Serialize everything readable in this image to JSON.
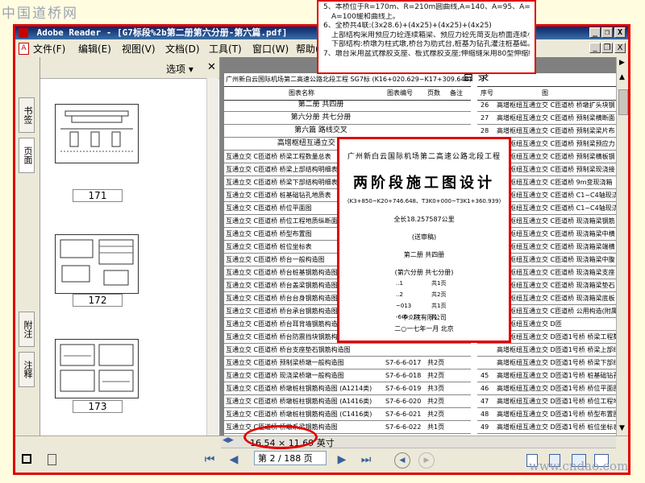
{
  "watermarks": {
    "top_left": "中国道桥网",
    "bottom_right": "www.cndao.com"
  },
  "window": {
    "title": "Adobe Reader - [G7标段%2b第二册第六分册-第六篇.pdf]",
    "minimize": "_",
    "restore": "❐",
    "close": "X"
  },
  "menubar": {
    "items": [
      "文件(F)",
      "编辑(E)",
      "视图(V)",
      "文档(D)",
      "工具(T)",
      "窗口(W)",
      "帮助(H)"
    ],
    "doc_min": "_",
    "doc_restore": "❐",
    "doc_close": "X"
  },
  "nav_tabs": [
    "书签",
    "页面",
    "附注",
    "注释"
  ],
  "pages_panel": {
    "options_label": "选项 ▾",
    "thumbnails": [
      {
        "num": "171"
      },
      {
        "num": "172"
      },
      {
        "num": "173"
      }
    ]
  },
  "doc": {
    "header_text": "广州新白云国际机场第二高速公路北段工程  SG7标  (K16+020.629~K17+309.648)",
    "left_col_headers": [
      "图表名称",
      "图表编号",
      "页数",
      "备注"
    ],
    "right_col_headers": [
      "序号",
      "图"
    ],
    "left_rows": [
      "第二册  共四册",
      "第六分册  共七分册",
      "第六篇  路线交叉",
      "高增枢纽互通立交  C匝道桥",
      "互通立交 C匝道桥 桥梁工程数量总表",
      "互通立交 C匝道桥 桥梁上部结构明细表",
      "互通立交 C匝道桥 桥梁下部结构明细表",
      "互通立交 C匝道桥 桩基础钻孔地质表",
      "互通立交 C匝道桥 桥位平面图",
      "互通立交 C匝道桥 桥位工程地质纵断面图",
      "互通立交 C匝道桥 桥型布置图",
      "互通立交 C匝道桥 桩位坐标表",
      "互通立交 C匝道桥 桥台一般构造图",
      "互通立交 C匝道桥 桥台桩基钢筋构造图 (",
      "互通立交 C匝道桥 桥台盖梁钢筋构造图",
      "互通立交 C匝道桥 桥台台身钢筋构造图",
      "互通立交 C匝道桥 桥台承台钢筋构造图",
      "互通立交 C匝道桥 桥台耳背墙钢筋构造图",
      "互通立交 C匝道桥 桥台防震挡块钢筋构造图",
      "互通立交 C匝道桥 桥台支座垫石钢筋构造图",
      "互通立交 C匝道桥 预制梁桥墩一般构造图",
      "互通立交 C匝道桥 现浇梁桥墩一般构造图",
      "互通立交 C匝道桥 桥墩桩柱钢筋构造图 (A1214类)",
      "互通立交 C匝道桥 桥墩桩柱钢筋构造图 (A1416类)",
      "互通立交 C匝道桥 桥墩桩柱钢筋构造图 (C1416类)",
      "互通立交 C匝道桥 桥墩系梁钢筋构造图"
    ],
    "left_codes": [
      {
        "code": "S7-6-6-017",
        "pages": "共2页"
      },
      {
        "code": "S7-6-6-018",
        "pages": "共2页"
      },
      {
        "code": "S7-6-6-019",
        "pages": "共3页"
      },
      {
        "code": "S7-6-6-020",
        "pages": "共2页"
      },
      {
        "code": "S7-6-6-021",
        "pages": "共2页"
      },
      {
        "code": "S7-6-6-022",
        "pages": "共1页"
      }
    ],
    "right_rows": [
      {
        "no": "26",
        "text": "高增枢纽互通立交 C匝道桥 桥墩扩头块钢"
      },
      {
        "no": "27",
        "text": "高增枢纽互通立交 C匝道桥 预制梁横断面"
      },
      {
        "no": "28",
        "text": "高增枢纽互通立交 C匝道桥 预制梁梁片布"
      },
      {
        "no": "",
        "text": "高增枢纽互通立交 C匝道桥 预制梁预应力"
      },
      {
        "no": "",
        "text": "高增枢纽互通立交 C匝道桥 预制梁横板钢"
      },
      {
        "no": "",
        "text": "高增枢纽互通立交 C匝道桥 预制梁现浇接"
      },
      {
        "no": "",
        "text": "高增枢纽互通立交 C匝道桥 9m变现浇箱"
      },
      {
        "no": "",
        "text": "高增枢纽互通立交 C匝道桥 C1~C4轴现浇"
      },
      {
        "no": "",
        "text": "高增枢纽互通立交 C匝道桥 C1~C4轴现浇"
      },
      {
        "no": "",
        "text": "高增枢纽互通立交 C匝道桥 现浇箱梁钢筋"
      },
      {
        "no": "",
        "text": "高增枢纽互通立交 C匝道桥 现浇箱梁中横"
      },
      {
        "no": "",
        "text": "高增枢纽互通立交 C匝道桥 现浇箱梁端横"
      },
      {
        "no": "",
        "text": "高增枢纽互通立交 C匝道桥 现浇箱梁中腹"
      },
      {
        "no": "",
        "text": "高增枢纽互通立交 C匝道桥 现浇箱梁支座"
      },
      {
        "no": "",
        "text": "高增枢纽互通立交 C匝道桥 现浇箱梁垫石"
      },
      {
        "no": "",
        "text": "高增枢纽互通立交 C匝道桥 现浇箱梁底板"
      },
      {
        "no": "",
        "text": "高增枢纽互通立交 C匝道桥 公用构造(附属"
      },
      {
        "no": "",
        "text": "高增枢纽互通立交  D匝"
      },
      {
        "no": "",
        "text": "高增枢纽互通立交 D匝道1号桥 桥梁工程数"
      },
      {
        "no": "",
        "text": "高增枢纽互通立交 D匝道1号桥 桥梁上部结"
      },
      {
        "no": "",
        "text": "高增枢纽互通立交 D匝道1号桥 桥梁下部结"
      },
      {
        "no": "45",
        "text": "高增枢纽互通立交 D匝道1号桥 桩基础钻孔"
      },
      {
        "no": "46",
        "text": "高增枢纽互通立交 D匝道1号桥 桥位平面图"
      },
      {
        "no": "47",
        "text": "高增枢纽互通立交 D匝道1号桥 桥位工程地"
      },
      {
        "no": "48",
        "text": "高增枢纽互通立交 D匝道1号桥 桥型布置图"
      },
      {
        "no": "49",
        "text": "高增枢纽互通立交 D匝道1号桥 桩位坐标表"
      },
      {
        "no": "50",
        "text": "高增枢纽互通立交 D匝道1号桥 桥台一般构"
      }
    ],
    "right_header_fragment": "目 录"
  },
  "notes": [
    "5、本桥位于R=170m、R=210m圆曲线,A=140、A=95、A=110、",
    "A=100缓和曲线上。",
    "6、全桥共4联:(3x28.6)+(4x25)+(4x25)+(4x25)",
    "上部结构采用预应力砼连续箱梁、预应力砼先简支后桥面连续小箱梁;",
    "下部结构:桥墩为柱式墩,桥台为肋式台,桩基为钻孔灌注桩基础。",
    "7、墩台采用盆式橡胶支座、板式橡胶支座;伸缩缝采用80型伸缩缝。"
  ],
  "cover": {
    "org_line": "广州新白云国际机场第二高速公路北段工程",
    "title": "两阶段施工图设计",
    "range": "(K3+850~K20+746.648、T3K0+000~T3K1+360.939)",
    "length": "全长18.257587公里",
    "review": "(送审稿)",
    "volume": "第二册    共四册",
    "part": "(第六分册  共七分册)",
    "list": [
      {
        "code": "..1",
        "pages": "共1页"
      },
      {
        "code": "..2",
        "pages": "共2页"
      },
      {
        "code": "~013",
        "pages": "共1页"
      },
      {
        "code": "-6-6-014",
        "pages": "共"
      }
    ],
    "company": "中...院有限公司",
    "date": "二○一七年一月  北京"
  },
  "statusbar": {
    "page_size": "16.54 × 11.69 英寸",
    "page_input": "第 2 / 188 页",
    "first": "⏮",
    "prev": "◀",
    "next": "▶",
    "last": "⏭",
    "back": "◀",
    "forward": "▶"
  },
  "colors": {
    "highlight": "#e00000",
    "titlebar": "#0a246a",
    "chrome": "#ece9d8"
  }
}
